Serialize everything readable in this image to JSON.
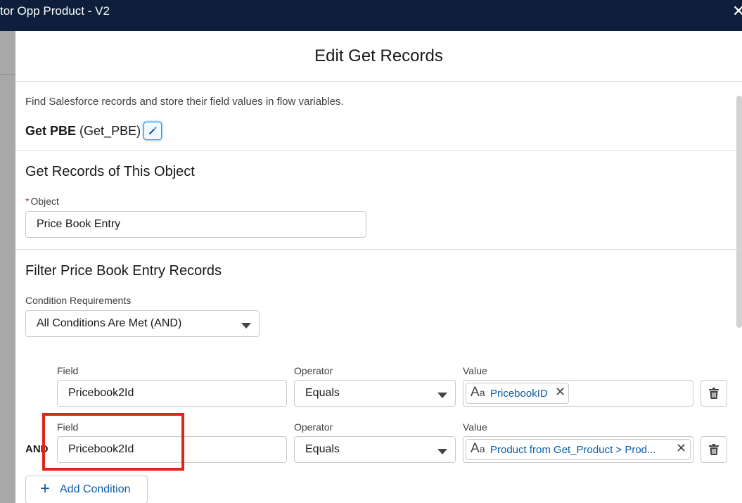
{
  "window": {
    "title": "tor Opp Product - V2",
    "close_glyph": "✕"
  },
  "modal": {
    "title": "Edit Get Records",
    "description": "Find Salesforce records and store their field values in flow variables.",
    "element_label": "Get PBE",
    "element_api_name": "(Get_PBE)"
  },
  "object_section": {
    "title": "Get Records of This Object",
    "required_mark": "*",
    "object_label": "Object",
    "object_value": "Price Book Entry"
  },
  "filter_section": {
    "title": "Filter Price Book Entry Records",
    "condition_requirements_label": "Condition Requirements",
    "condition_requirements_value": "All Conditions Are Met (AND)",
    "conditions": [
      {
        "prefix": "",
        "field_label": "Field",
        "field_value": "Pricebook2Id",
        "operator_label": "Operator",
        "operator_value": "Equals",
        "value_label": "Value",
        "value_text": "PricebookID"
      },
      {
        "prefix": "AND",
        "field_label": "Field",
        "field_value": "Pricebook2Id",
        "operator_label": "Operator",
        "operator_value": "Equals",
        "value_label": "Value",
        "value_text": "Product from Get_Product > Prod..."
      }
    ],
    "add_condition_label": "Add Condition"
  },
  "icons": {
    "edit": "pencil-icon",
    "text_type": "text-type-icon",
    "clear": "close-icon",
    "delete": "trash-icon",
    "add": "plus-icon",
    "dropdown": "chevron-down-icon"
  },
  "colors": {
    "header_bg": "#0d1f3a",
    "link_blue": "#0b5cab",
    "focus_blue": "#1b96ff",
    "required_red": "#c23934",
    "highlight_red": "#e2231a"
  }
}
